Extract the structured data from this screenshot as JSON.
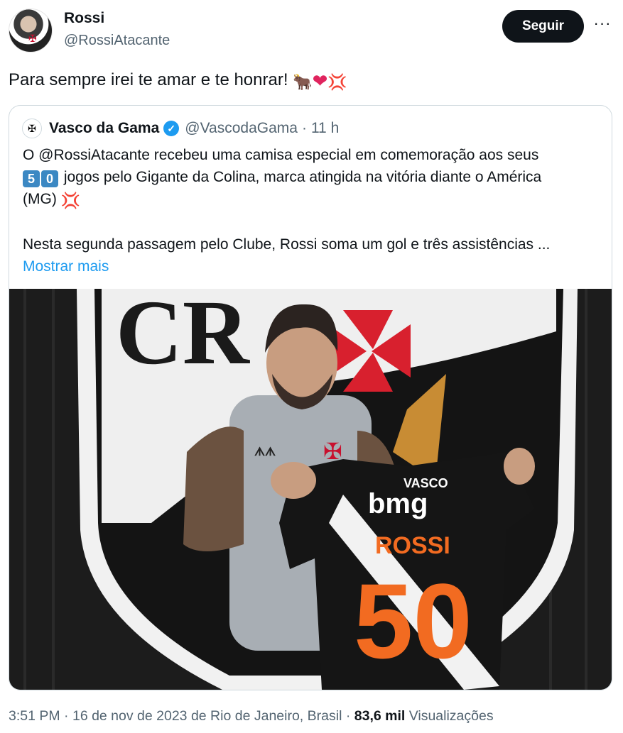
{
  "author": {
    "name": "Rossi",
    "handle": "@RossiAtacante"
  },
  "actions": {
    "follow_label": "Seguir",
    "more_label": "···"
  },
  "tweet": {
    "text": "Para sempre irei te amar e te honrar!",
    "emojis": [
      "bull-emoji",
      "red-heart-emoji",
      "anger-symbol-emoji"
    ]
  },
  "quoted": {
    "name": "Vasco da Gama",
    "handle": "@VascodaGama",
    "separator": "·",
    "time": "11 h",
    "line1": "O @RossiAtacante  recebeu uma camisa especial em comemoração aos seus",
    "keycap1": "5",
    "keycap2": "0",
    "line2_rest": " jogos pelo Gigante da Colina, marca atingida na vitória diante o América",
    "line3": "(MG) ",
    "paragraph2": "Nesta segunda passagem pelo Clube, Rossi soma um gol e três assistências ...",
    "show_more": "Mostrar mais",
    "image": {
      "jersey_sponsor": "bmg",
      "jersey_brand": "VASCO",
      "jersey_name": "ROSSI",
      "jersey_number": "50"
    }
  },
  "meta": {
    "time": "3:51 PM",
    "separator": "·",
    "date": "16 de nov de 2023",
    "location": "de Rio de Janeiro, Brasil",
    "views_count": "83,6 mil",
    "views_label": "Visualizações"
  },
  "colors": {
    "accent": "#1d9bf0",
    "text": "#0f1419",
    "muted": "#536471",
    "vasco_red": "#c8102e",
    "jersey_orange": "#f26b21"
  }
}
